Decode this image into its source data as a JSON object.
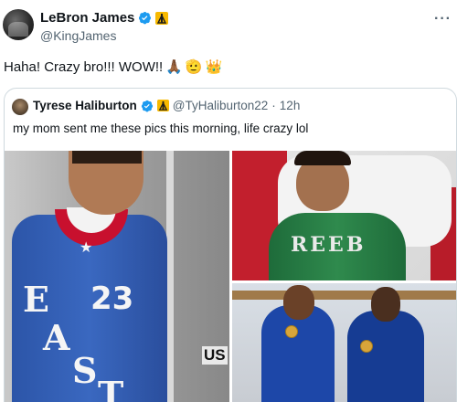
{
  "author": {
    "name": "LeBron James",
    "handle": "@KingJames"
  },
  "tweet": {
    "text": "Haha! Crazy bro!!! WOW!!",
    "emojis": [
      "🙏🏾",
      "🫡",
      "👑"
    ]
  },
  "quote": {
    "name": "Tyrese Haliburton",
    "handle": "@TyHaliburton22",
    "separator": "·",
    "time": "12h",
    "text": "my mom sent me these pics this morning, life crazy lol"
  },
  "more_label": "···",
  "photo_left": {
    "jersey_letters": [
      "E",
      "A",
      "S",
      "T"
    ],
    "jersey_number": "23",
    "sign_text": "US"
  },
  "photo_top_right": {
    "jersey_text": "REEB"
  },
  "colors": {
    "verified": "#1d9bf0",
    "affiliate": "#f7b900",
    "text": "#0f1419",
    "muted": "#536471"
  },
  "icons": {
    "verified": "verified-badge-icon",
    "affiliate": "affiliate-badge-icon",
    "more": "more-options-icon"
  }
}
